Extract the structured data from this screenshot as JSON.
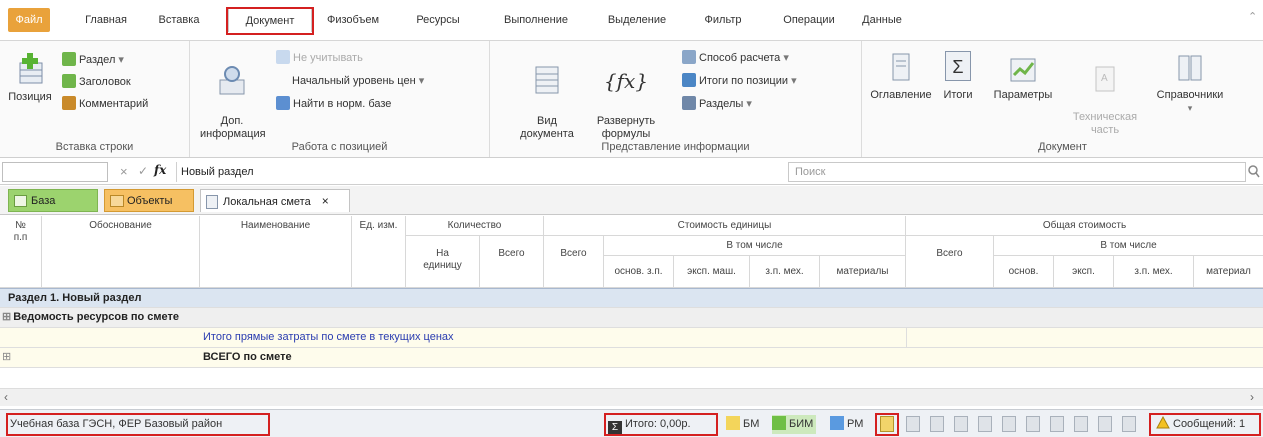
{
  "ribbon_tabs": [
    "Файл",
    "Главная",
    "Вставка",
    "Документ",
    "Физобъем",
    "Ресурсы",
    "Выполнение",
    "Выделение",
    "Фильтр",
    "Операции",
    "Данные"
  ],
  "insert_group": {
    "position_label": "Позиция",
    "section": "Раздел",
    "header": "Заголовок",
    "comment": "Комментарий",
    "group_label": "Вставка строки"
  },
  "position_group": {
    "dop_info": "Доп.\nинформация",
    "not_count": "Не учитывать",
    "price_level": "Начальный уровень цен",
    "find_norm": "Найти в норм. базе",
    "group_label": "Работа с позицией"
  },
  "view_group": {
    "doc_view": "Вид\nдокумента",
    "expand": "Развернуть\nформулы",
    "calc_method": "Способ расчета",
    "pos_totals": "Итоги по позиции",
    "sections": "Разделы",
    "group_label": "Представление информации"
  },
  "doc_group": {
    "contents": "Оглавление",
    "totals": "Итоги",
    "params": "Параметры",
    "tech_part": "Техническая\nчасть",
    "refs": "Справочники",
    "group_label": "Документ"
  },
  "formula_bar": {
    "value": "Новый раздел",
    "fx": "fx",
    "cancel": "×",
    "ok": "✓",
    "search_placeholder": "Поиск"
  },
  "doc_tabs": {
    "base": "База",
    "objects": "Объекты",
    "estimate": "Локальная смета",
    "close": "×"
  },
  "table_headers": {
    "num": "№\nп.п",
    "basis": "Обоснование",
    "name": "Наименование",
    "unit": "Ед. изм.",
    "qty": "Количество",
    "qty_per": "На\nединицу",
    "qty_total": "Всего",
    "unit_cost": "Стоимость единицы",
    "uc_total": "Всего",
    "uc_incl": "В том числе",
    "uc_main": "основ. з.п.",
    "uc_mach": "эксп. маш.",
    "uc_mech": "з.п. мех.",
    "uc_mat": "материалы",
    "total_cost": "Общая стоимость",
    "tc_total": "Всего",
    "tc_incl": "В том числе",
    "tc_main": "основ.",
    "tc_mach": "эксп.",
    "tc_mech": "з.п. мех.",
    "tc_mat": "материал"
  },
  "rows": {
    "section": "Раздел 1. Новый раздел",
    "resources": "Ведомость ресурсов по смете",
    "direct": "Итого прямые затраты по смете в текущих ценах",
    "total": "ВСЕГО по смете"
  },
  "status": {
    "base": "Учебная база ГЭСН, ФЕР  Базовый район",
    "sum": "Итого: 0,00р.",
    "bm": "БМ",
    "bim": "БИМ",
    "rm": "РМ",
    "messages": "Сообщений: 1"
  },
  "colors": {
    "accent_red": "#d42020",
    "file_tab": "#e9a23b",
    "section_row": "#dbe5f1",
    "resource_row": "#efefef",
    "direct_row": "#fefcec"
  }
}
